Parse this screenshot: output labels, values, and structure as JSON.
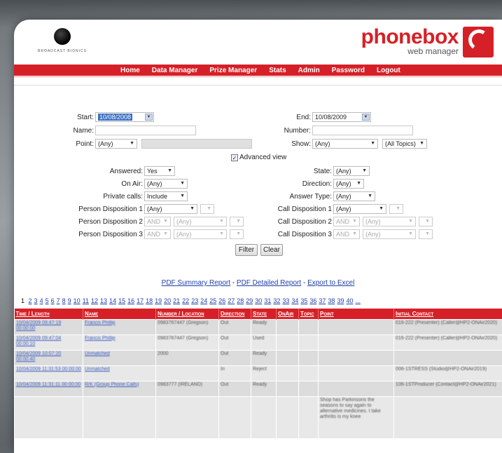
{
  "header": {
    "left_logo_text": "BROADCAST BIONICS",
    "brand_title": "phonebox",
    "brand_subtitle": "web manager",
    "nav": [
      "Home",
      "Data Manager",
      "Prize Manager",
      "Stats",
      "Admin",
      "Password",
      "Logout"
    ]
  },
  "form": {
    "start_label": "Start:",
    "start_value": "10/08/2008",
    "end_label": "End:",
    "end_value": "10/08/2009",
    "name_label": "Name:",
    "number_label": "Number:",
    "point_label": "Point:",
    "point_value": "(Any)",
    "show_label": "Show:",
    "show_value": "(Any)",
    "topics_value": "(All Topics)",
    "advanced_label": "Advanced view",
    "answered_label": "Answered:",
    "answered_value": "Yes",
    "state_label": "State:",
    "state_value": "(Any)",
    "onair_label": "On Air:",
    "onair_value": "(Any)",
    "direction_label": "Direction:",
    "direction_value": "(Any)",
    "private_label": "Private calls:",
    "private_value": "Include",
    "answertype_label": "Answer Type:",
    "answertype_value": "(Any)",
    "person_disp1_label": "Person Disposition 1",
    "person_disp2_label": "Person Disposition 2",
    "person_disp3_label": "Person Disposition 3",
    "call_disp1_label": "Call Disposition 1",
    "call_disp2_label": "Call Disposition 2",
    "call_disp3_label": "Call Disposition 3",
    "any_value": "(Any)",
    "and_value": "AND",
    "filter_button": "Filter",
    "clear_button": "Clear"
  },
  "reports": {
    "pdf_summary": "PDF Summary Report",
    "pdf_detailed": "PDF Detailed Report",
    "export_excel": "Export to Excel",
    "separator": " - "
  },
  "pager": {
    "current": "1",
    "pages": [
      "2",
      "3",
      "4",
      "5",
      "6",
      "7",
      "8",
      "9",
      "10",
      "11",
      "12",
      "13",
      "14",
      "15",
      "16",
      "17",
      "18",
      "19",
      "20",
      "21",
      "22",
      "23",
      "24",
      "25",
      "26",
      "27",
      "28",
      "29",
      "30",
      "31",
      "32",
      "33",
      "34",
      "35",
      "36",
      "37",
      "38",
      "39",
      "40",
      "..."
    ]
  },
  "table": {
    "columns": [
      "Time / Length",
      "Name",
      "Number / Location",
      "Direction",
      "State",
      "OnAir",
      "Topic",
      "Point",
      "Initial Contact"
    ],
    "rows": [
      {
        "time": "10/04/2009 09:47:19 00:00:00",
        "name": "Francis Phillip",
        "number": "0983767447 (Gregson)",
        "direction": "Out",
        "state": "Ready",
        "point": "",
        "contact": "016-222 (Presenter) (Caller@HP2-ONAir2020)"
      },
      {
        "time": "10/04/2009 09:47:04 00:00:10",
        "name": "Francis Phillip",
        "number": "0983767447 (Gregson)",
        "direction": "Out",
        "state": "Used",
        "point": "",
        "contact": "016-222 (Presenter) (Caller@HP2-ONAir2020)"
      },
      {
        "time": "10/04/2009 10:07:20 00:00:40",
        "name": "Unmatched",
        "number": "2000",
        "direction": "Out",
        "state": "Ready",
        "point": "",
        "contact": ""
      },
      {
        "time": "10/04/2009 11:31:53 00:00:00",
        "name": "Unmatched",
        "number": "",
        "direction": "In",
        "state": "Reject",
        "point": "",
        "contact": "006-1STRESS (Studio@HP2-ONAir2019)"
      },
      {
        "time": "10/04/2009 11:31:11 00:00:00",
        "name": "R/K (Group Phone Calls)",
        "number": "0983777 (IRELAND)",
        "direction": "Out",
        "state": "Ready",
        "point": "",
        "contact": "106-1STProducer (Contact@HP2-ONAir2021)"
      },
      {
        "time": "",
        "name": "",
        "number": "",
        "direction": "",
        "state": "",
        "point": "Shop has Parkinsons the seasons to say again to alternative medicines. I take arthritis is my knee",
        "contact": ""
      }
    ]
  }
}
